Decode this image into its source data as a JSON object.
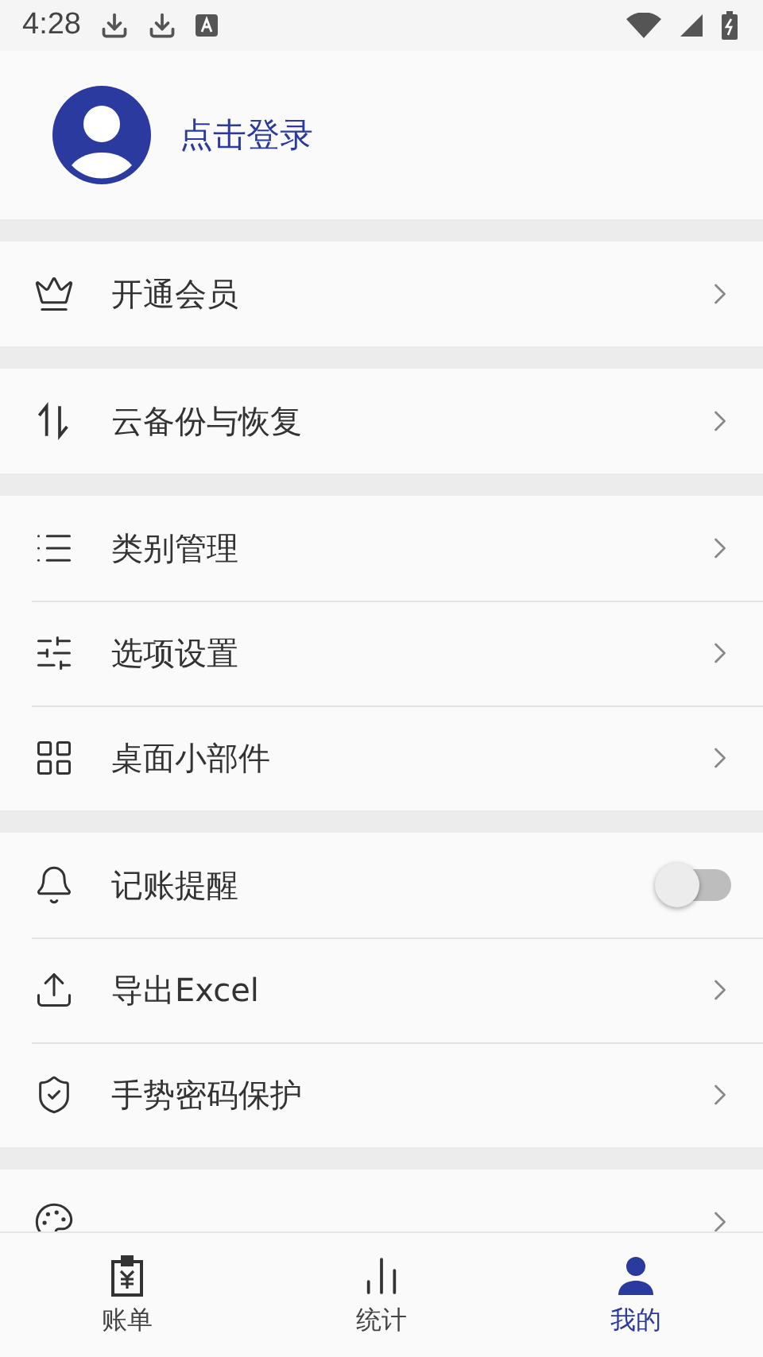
{
  "status_bar": {
    "time": "4:28"
  },
  "profile": {
    "label": "点击登录"
  },
  "sections": [
    [
      {
        "kind": "link",
        "label": "开通会员"
      }
    ],
    [
      {
        "kind": "link",
        "label": "云备份与恢复"
      }
    ],
    [
      {
        "kind": "link",
        "label": "类别管理"
      },
      {
        "kind": "link",
        "label": "选项设置"
      },
      {
        "kind": "link",
        "label": "桌面小部件"
      }
    ],
    [
      {
        "kind": "toggle",
        "label": "记账提醒",
        "on": false
      },
      {
        "kind": "link",
        "label": "导出Excel"
      },
      {
        "kind": "link",
        "label": "手势密码保护"
      }
    ],
    [
      {
        "kind": "link"
      }
    ]
  ],
  "bottom_nav": [
    {
      "label": "账单",
      "selected": false
    },
    {
      "label": "统计",
      "selected": false
    },
    {
      "label": "我的",
      "selected": true
    }
  ]
}
